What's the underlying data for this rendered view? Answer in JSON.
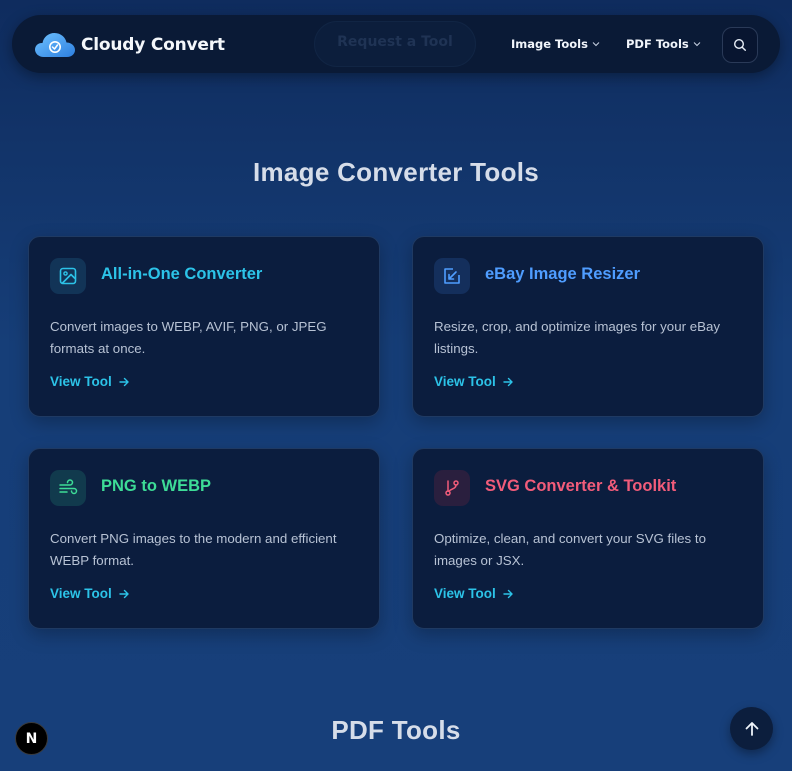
{
  "header": {
    "brand": "Cloudy Convert",
    "request_label": "Request a Tool",
    "nav": [
      {
        "label": "Image Tools"
      },
      {
        "label": "PDF Tools"
      }
    ]
  },
  "sections": [
    {
      "title": "Image Converter Tools",
      "cards": [
        {
          "title": "All-in-One Converter",
          "description": "Convert images to WEBP, AVIF, PNG, or JPEG formats at once.",
          "link": "View Tool",
          "icon": "image-icon",
          "accent": "#2cc3e8"
        },
        {
          "title": "eBay Image Resizer",
          "description": "Resize, crop, and optimize images for your eBay listings.",
          "link": "View Tool",
          "icon": "resize-arrow-icon",
          "accent": "#4f9dff"
        },
        {
          "title": "PNG to WEBP",
          "description": "Convert PNG images to the modern and efficient WEBP format.",
          "link": "View Tool",
          "icon": "wind-icon",
          "accent": "#3ddc97"
        },
        {
          "title": "SVG Converter & Toolkit",
          "description": "Optimize, clean, and convert your SVG files to images or JSX.",
          "link": "View Tool",
          "icon": "git-branch-icon",
          "accent": "#f25c7a"
        }
      ]
    },
    {
      "title": "PDF Tools"
    }
  ],
  "badge_letter": "N"
}
